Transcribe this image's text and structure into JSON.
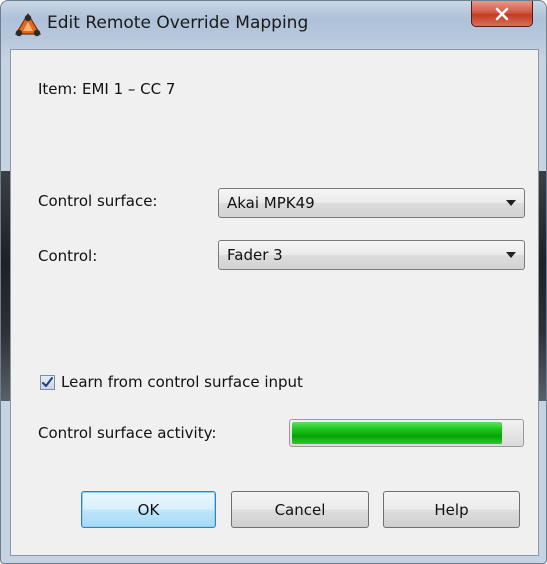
{
  "window": {
    "title": "Edit Remote Override Mapping",
    "close_glyph": "x"
  },
  "item": {
    "text": "Item: EMI 1 – CC 7"
  },
  "control_surface": {
    "label": "Control surface:",
    "value": "Akai MPK49"
  },
  "control": {
    "label": "Control:",
    "value": "Fader 3"
  },
  "learn": {
    "label": "Learn from control surface input",
    "checked": true
  },
  "activity": {
    "label": "Control surface activity:",
    "level_percent": 92,
    "fill_color": "#19c319"
  },
  "buttons": {
    "ok": "OK",
    "cancel": "Cancel",
    "help": "Help"
  },
  "icons": {
    "app": "reason-app-icon",
    "close": "close-icon",
    "checkmark": "checkmark-icon",
    "dropdown": "chevron-down-icon"
  }
}
